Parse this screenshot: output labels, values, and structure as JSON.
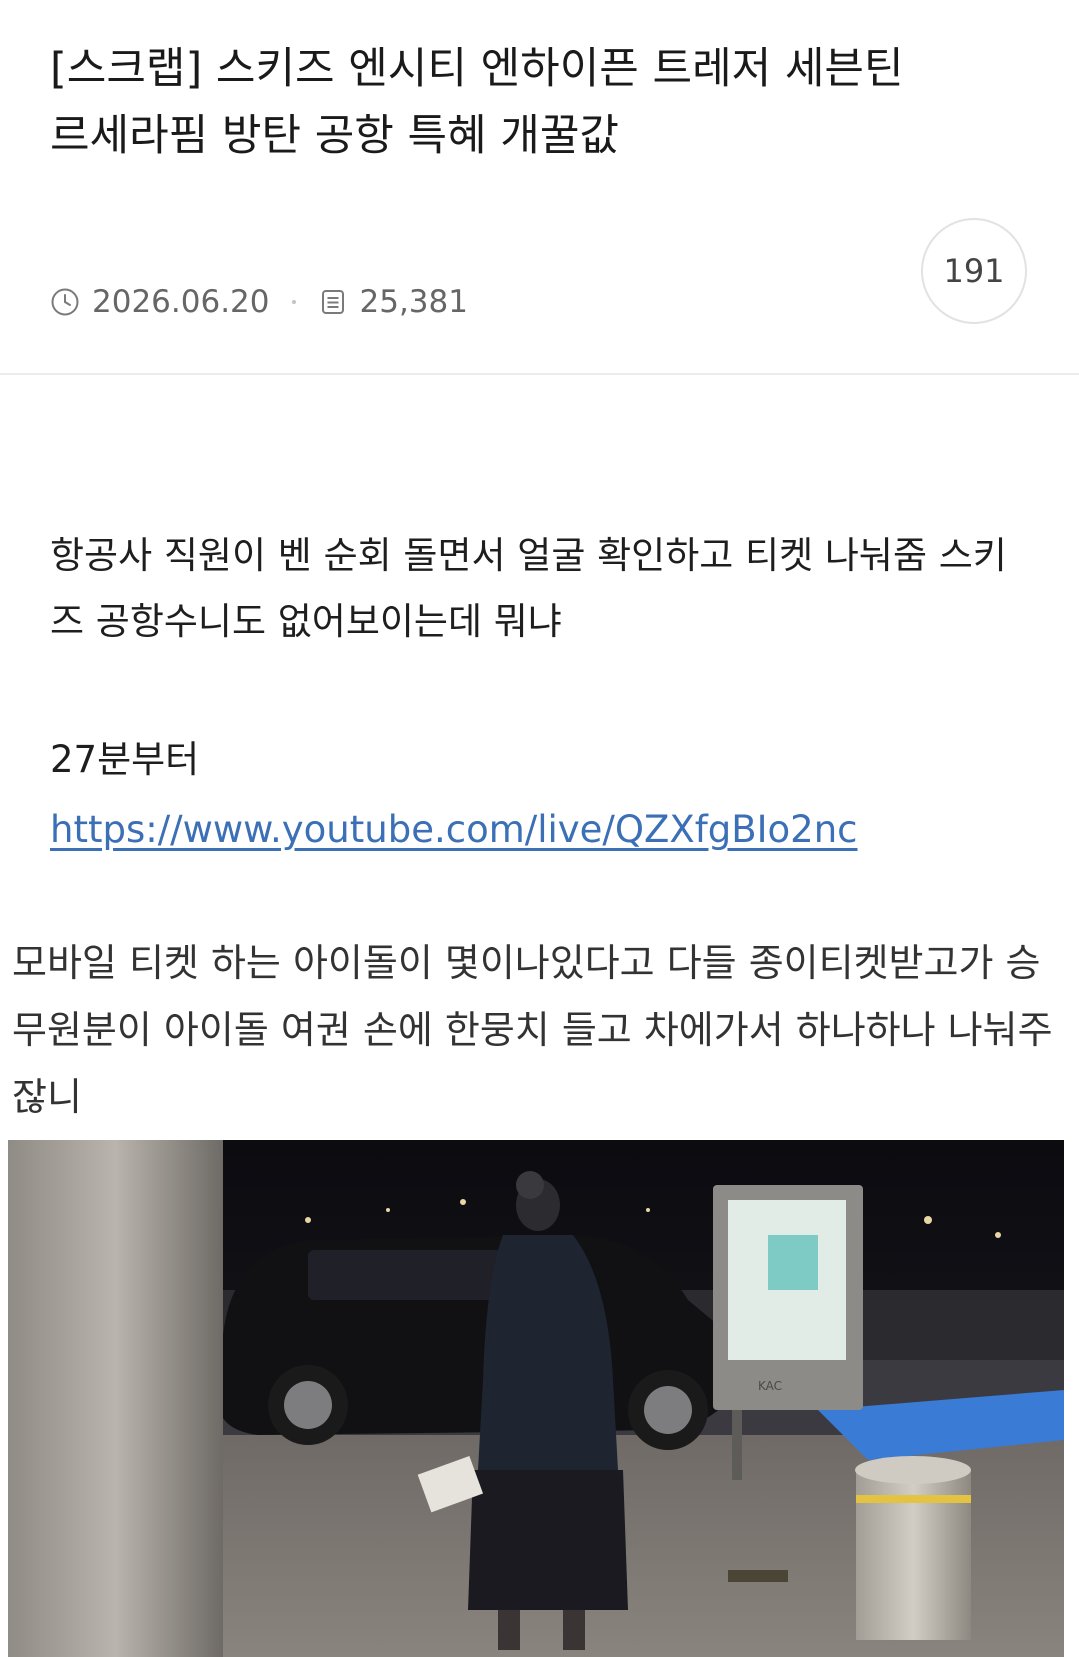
{
  "post": {
    "title": "[스크랩] 스키즈 엔시티 엔하이픈 트레저 세븐틴 르세라핌 방탄 공항 특혜 개꿀값",
    "date": "2026.06.20",
    "views": "25,381",
    "comment_count": "191",
    "icons": {
      "date": "clock-icon",
      "views": "document-icon"
    }
  },
  "content": {
    "paragraph1": "항공사 직원이 벤 순회 돌면서 얼굴 확인하고 티켓 나눠줌 스키즈 공항수니도 없어보이는데 뭐냐",
    "timestamp_note": "27분부터",
    "link": "https://www.youtube.com/live/QZXfgBIo2nc",
    "scrap_text": "모바일 티켓 하는 아이돌이 몇이나있다고 다들 종이티켓받고가 승무원분이 아이돌 여권 손에 한뭉치 들고 차에가서 하나하나 나눠주잖니",
    "photo_sign_text": "KAC"
  },
  "colors": {
    "link": "#3b6fb6",
    "text": "#1e1e1e",
    "meta": "#666666",
    "divider": "#ececec"
  }
}
